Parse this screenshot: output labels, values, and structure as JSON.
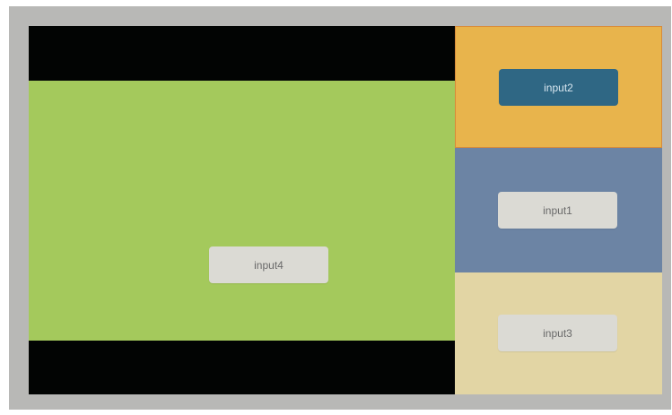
{
  "layout_panels": {
    "main": {
      "label": "input4",
      "video_color": "#a4c95c",
      "letterbox_color": "#020403"
    },
    "side": [
      {
        "label": "input2",
        "background": "#e8b44c",
        "selected": true
      },
      {
        "label": "input1",
        "background": "#6c84a4",
        "selected": false
      },
      {
        "label": "input3",
        "background": "#e2d5a4",
        "selected": false
      }
    ]
  },
  "colors": {
    "screen_frame": "#b8b8b6",
    "selected_button": "#2f6784",
    "button": "#dbdad4"
  }
}
